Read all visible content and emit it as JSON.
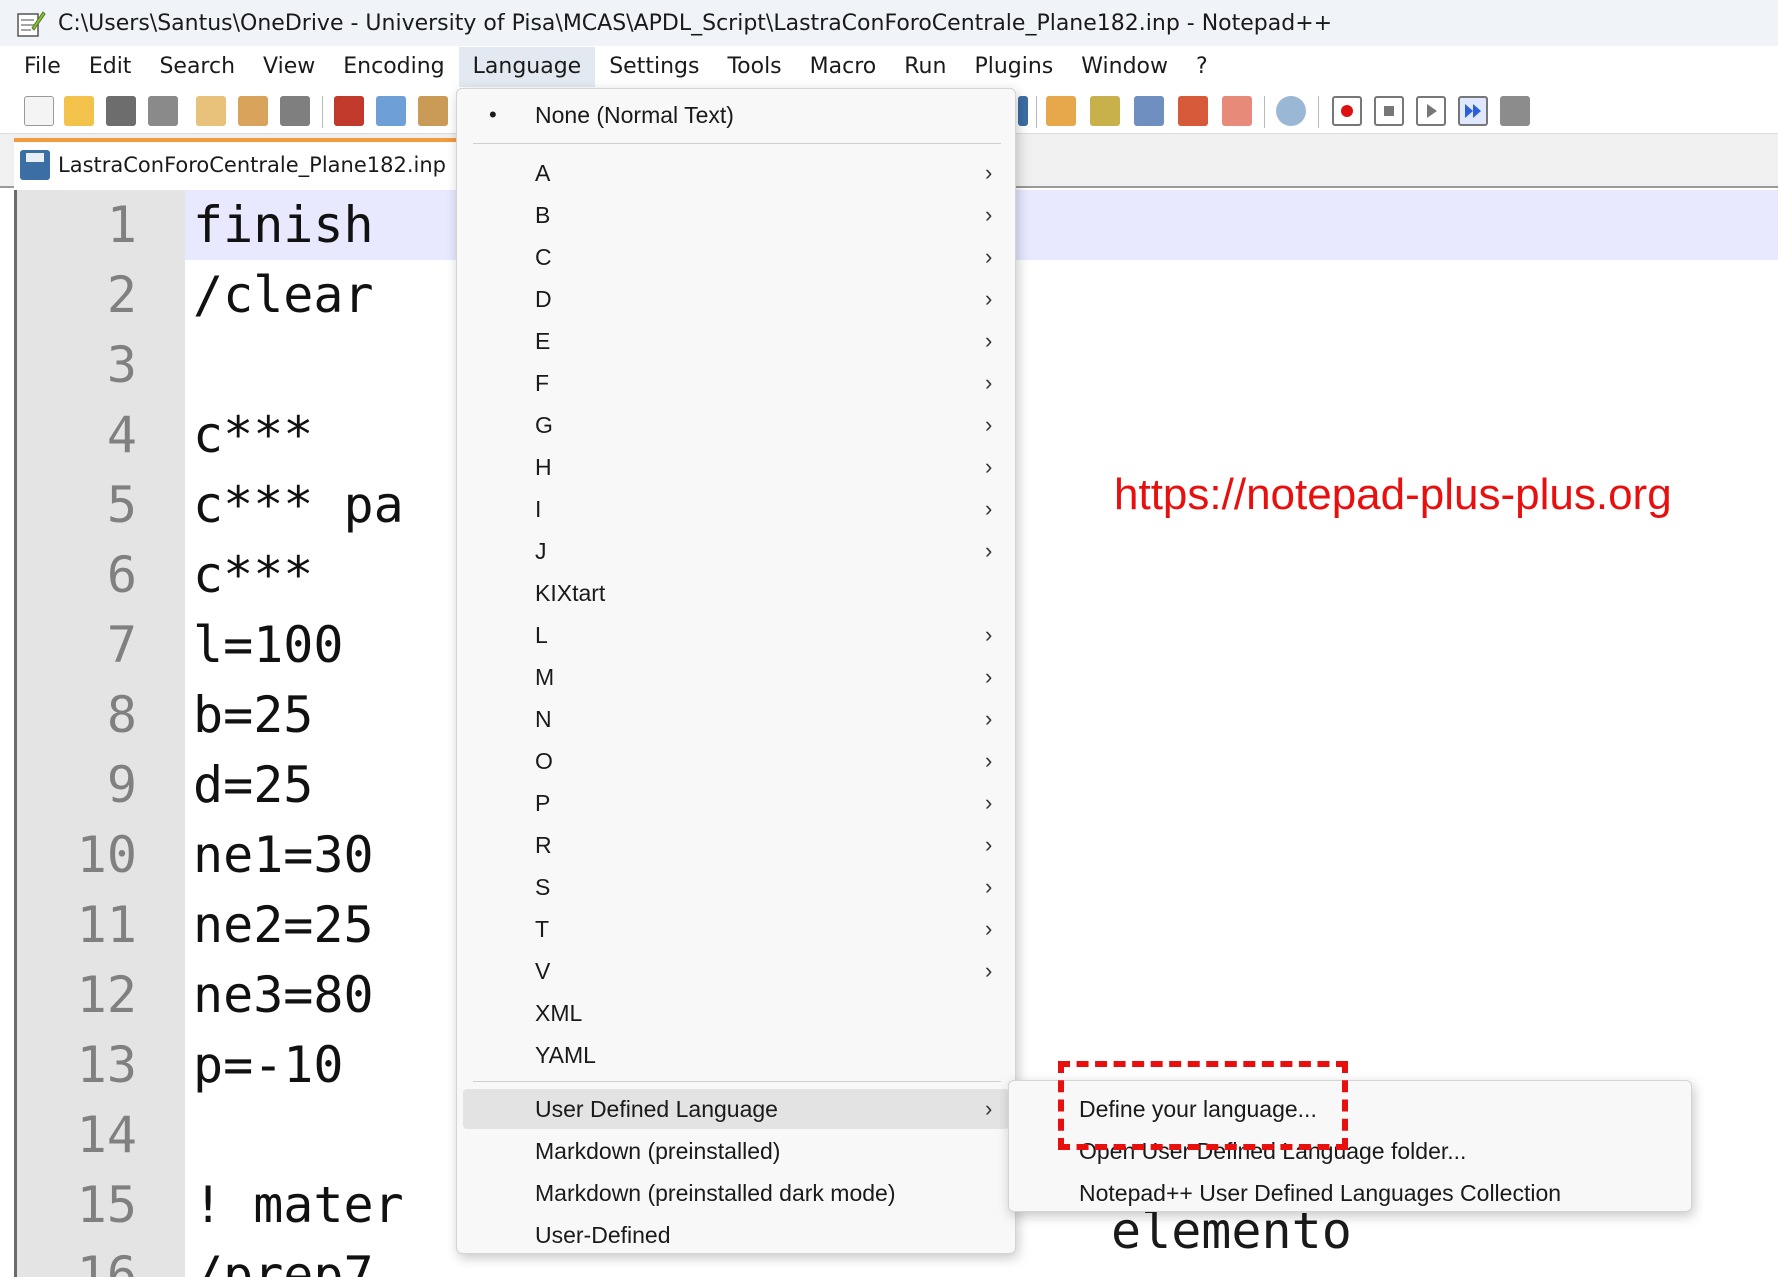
{
  "window": {
    "title": "C:\\Users\\Santus\\OneDrive - University of Pisa\\MCAS\\APDL_Script\\LastraConForoCentrale_Plane182.inp - Notepad++",
    "icon": "notepad-icon"
  },
  "menubar": {
    "items": [
      "File",
      "Edit",
      "Search",
      "View",
      "Encoding",
      "Language",
      "Settings",
      "Tools",
      "Macro",
      "Run",
      "Plugins",
      "Window",
      "?"
    ],
    "active": "Language"
  },
  "tab": {
    "label": "LastraConForoCentrale_Plane182.inp",
    "icon": "save-icon"
  },
  "editor": {
    "lines": [
      {
        "n": "1",
        "text": "finish"
      },
      {
        "n": "2",
        "text": "/clear"
      },
      {
        "n": "3",
        "text": ""
      },
      {
        "n": "4",
        "text": "c***"
      },
      {
        "n": "5",
        "text": "c*** pa"
      },
      {
        "n": "6",
        "text": "c***"
      },
      {
        "n": "7",
        "text": "l=100"
      },
      {
        "n": "8",
        "text": "b=25"
      },
      {
        "n": "9",
        "text": "d=25"
      },
      {
        "n": "10",
        "text": "ne1=30"
      },
      {
        "n": "11",
        "text": "ne2=25"
      },
      {
        "n": "12",
        "text": "ne3=80"
      },
      {
        "n": "13",
        "text": "p=-10"
      },
      {
        "n": "14",
        "text": ""
      },
      {
        "n": "15",
        "text": "! mater"
      },
      {
        "n": "16",
        "text": "/prep7"
      }
    ],
    "behind_submenu_text": "elemento"
  },
  "annotation": {
    "url": "https://notepad-plus-plus.org",
    "color": "#e8100e"
  },
  "language_menu": {
    "selected": "None (Normal Text)",
    "letters": [
      {
        "label": "A",
        "submenu": true
      },
      {
        "label": "B",
        "submenu": true
      },
      {
        "label": "C",
        "submenu": true
      },
      {
        "label": "D",
        "submenu": true
      },
      {
        "label": "E",
        "submenu": true
      },
      {
        "label": "F",
        "submenu": true
      },
      {
        "label": "G",
        "submenu": true
      },
      {
        "label": "H",
        "submenu": true
      },
      {
        "label": "I",
        "submenu": true
      },
      {
        "label": "J",
        "submenu": true
      },
      {
        "label": "KIXtart",
        "submenu": false
      },
      {
        "label": "L",
        "submenu": true
      },
      {
        "label": "M",
        "submenu": true
      },
      {
        "label": "N",
        "submenu": true
      },
      {
        "label": "O",
        "submenu": true
      },
      {
        "label": "P",
        "submenu": true
      },
      {
        "label": "R",
        "submenu": true
      },
      {
        "label": "S",
        "submenu": true
      },
      {
        "label": "T",
        "submenu": true
      },
      {
        "label": "V",
        "submenu": true
      },
      {
        "label": "XML",
        "submenu": false
      },
      {
        "label": "YAML",
        "submenu": false
      }
    ],
    "bottom": [
      {
        "label": "User Defined Language",
        "submenu": true,
        "hover": true
      },
      {
        "label": "Markdown (preinstalled)",
        "submenu": false
      },
      {
        "label": "Markdown (preinstalled dark mode)",
        "submenu": false
      },
      {
        "label": "User-Defined",
        "submenu": false
      }
    ],
    "arrow_glyph": "›",
    "bullet_glyph": "•"
  },
  "udl_submenu": {
    "items": [
      "Define your language...",
      "Open User Defined Language folder...",
      "Notepad++ User Defined Languages Collection"
    ]
  }
}
